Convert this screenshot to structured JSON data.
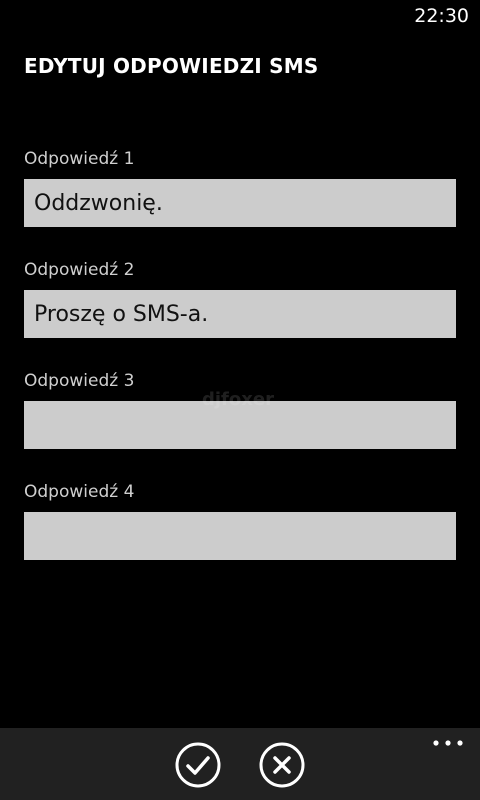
{
  "status_bar": {
    "time": "22:30"
  },
  "header": {
    "title": "EDYTUJ ODPOWIEDZI SMS"
  },
  "fields": [
    {
      "label": "Odpowiedź 1",
      "value": "Oddzwonię."
    },
    {
      "label": "Odpowiedź 2",
      "value": "Proszę o SMS-a."
    },
    {
      "label": "Odpowiedź 3",
      "value": ""
    },
    {
      "label": "Odpowiedź 4",
      "value": ""
    }
  ],
  "watermark": "djfoxer",
  "app_bar": {
    "confirm_icon": "checkmark-icon",
    "cancel_icon": "close-icon",
    "more_icon": "ellipsis-icon"
  },
  "colors": {
    "background": "#000000",
    "field_background": "#cccccc",
    "app_bar_background": "#212121",
    "label_text": "#cfcfcf"
  }
}
